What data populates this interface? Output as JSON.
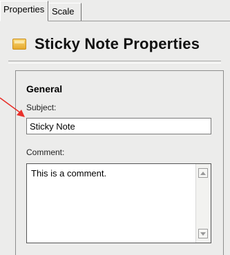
{
  "tabs": [
    {
      "label": "Properties",
      "active": true
    },
    {
      "label": "Scale",
      "active": false
    }
  ],
  "header": {
    "icon": "sticky-note-icon",
    "title": "Sticky Note Properties"
  },
  "general": {
    "title": "General",
    "subject_label": "Subject:",
    "subject_value": "Sticky Note",
    "comment_label": "Comment:",
    "comment_value": "This is a comment."
  },
  "colors": {
    "panel_background": "#ececeb",
    "callout_arrow": "#e8302a"
  }
}
